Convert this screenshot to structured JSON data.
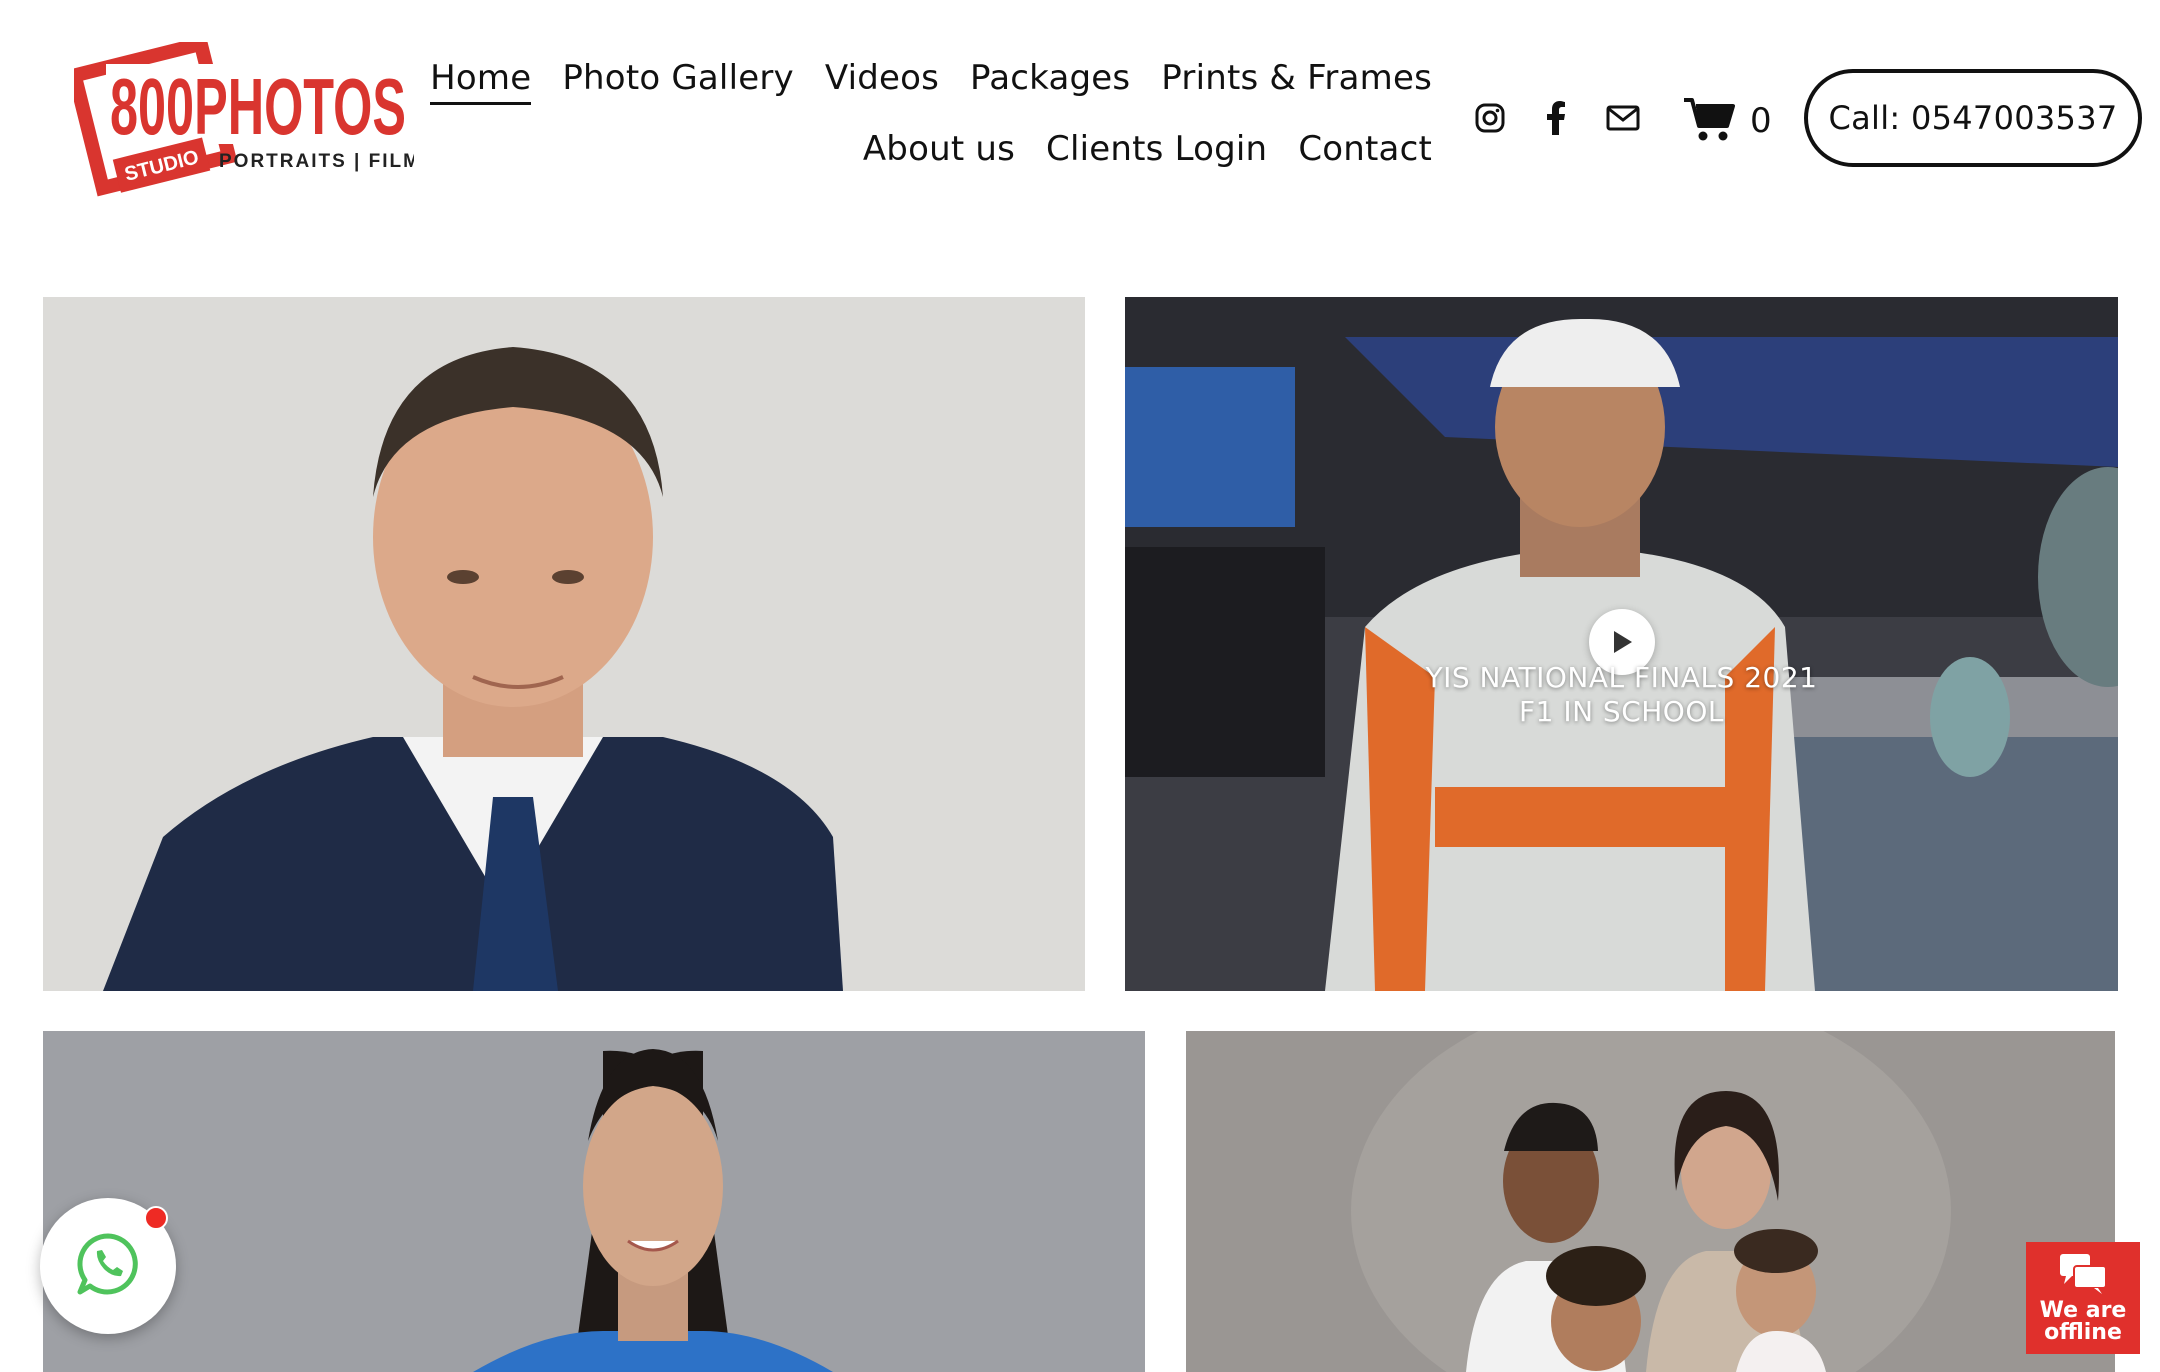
{
  "brand": {
    "name": "800PHOTOS",
    "studio": "STUDIO",
    "tagline": "PORTRAITS | FILMS",
    "color": "#d9352f"
  },
  "nav": {
    "row1": [
      {
        "label": "Home",
        "active": true
      },
      {
        "label": "Photo Gallery"
      },
      {
        "label": "Videos"
      },
      {
        "label": "Packages"
      },
      {
        "label": "Prints & Frames"
      }
    ],
    "row2": [
      {
        "label": "About us"
      },
      {
        "label": "Clients Login"
      },
      {
        "label": "Contact"
      }
    ]
  },
  "social": {
    "icons": [
      "instagram-icon",
      "facebook-icon",
      "email-icon"
    ]
  },
  "cart": {
    "icon": "cart-icon",
    "count": "0"
  },
  "call_button": {
    "label": "Call: 0547003537"
  },
  "video": {
    "title_line1": "YIS NATIONAL FINALS 2021",
    "title_line2": "F1 IN SCHOOL"
  },
  "whatsapp": {
    "icon": "whatsapp-icon",
    "accent": "#4fc35c",
    "notification_color": "#ee2a24"
  },
  "chat_status": {
    "line1": "We are",
    "line2": "offline",
    "color": "#e0302c"
  }
}
